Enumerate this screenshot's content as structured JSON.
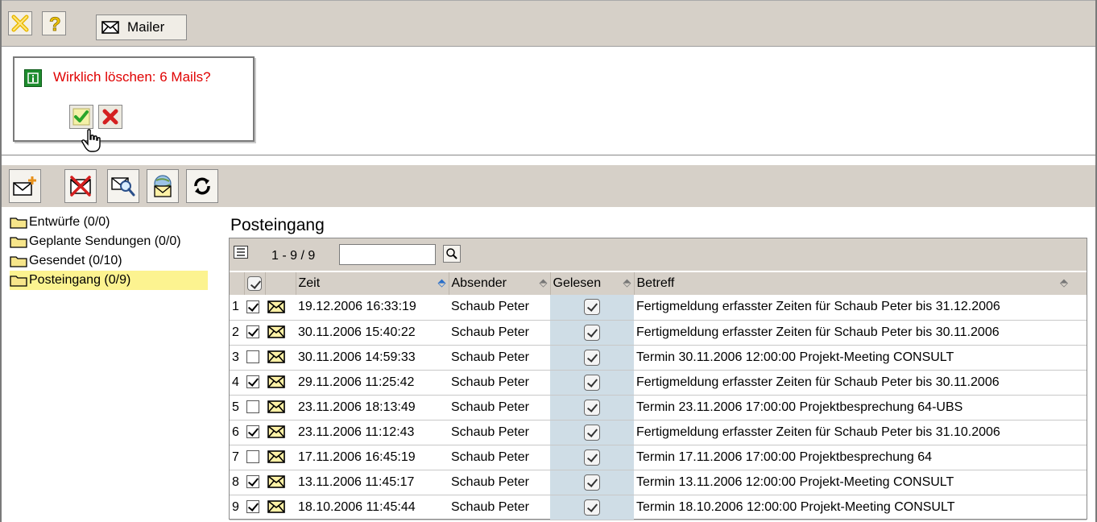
{
  "topbar": {
    "close_icon": "close-x-icon",
    "help_icon": "help-question-icon",
    "mailer_label": "Mailer"
  },
  "dialog": {
    "message": "Wirklich löschen: 6 Mails?",
    "confirm_icon": "check-icon",
    "cancel_icon": "cancel-x-icon"
  },
  "folders": [
    {
      "label": "Entwürfe (0/0)",
      "selected": false
    },
    {
      "label": "Geplante Sendungen (0/0)",
      "selected": false
    },
    {
      "label": "Gesendet (0/10)",
      "selected": false
    },
    {
      "label": "Posteingang (0/9)",
      "selected": true
    }
  ],
  "inbox": {
    "title": "Posteingang",
    "range": "1 - 9 / 9",
    "search_value": "",
    "columns": {
      "zeit": "Zeit",
      "absender": "Absender",
      "gelesen": "Gelesen",
      "betreff": "Betreff"
    },
    "rows": [
      {
        "num": "1",
        "checked": true,
        "zeit": "19.12.2006 16:33:19",
        "absender": "Schaub Peter",
        "betreff": "Fertigmeldung erfasster Zeiten für Schaub Peter bis 31.12.2006"
      },
      {
        "num": "2",
        "checked": true,
        "zeit": "30.11.2006 15:40:22",
        "absender": "Schaub Peter",
        "betreff": "Fertigmeldung erfasster Zeiten für Schaub Peter bis 30.11.2006"
      },
      {
        "num": "3",
        "checked": false,
        "zeit": "30.11.2006 14:59:33",
        "absender": "Schaub Peter",
        "betreff": "Termin 30.11.2006 12:00:00 Projekt-Meeting CONSULT"
      },
      {
        "num": "4",
        "checked": true,
        "zeit": "29.11.2006 11:25:42",
        "absender": "Schaub Peter",
        "betreff": "Fertigmeldung erfasster Zeiten für Schaub Peter bis 30.11.2006"
      },
      {
        "num": "5",
        "checked": false,
        "zeit": "23.11.2006 18:13:49",
        "absender": "Schaub Peter",
        "betreff": "Termin 23.11.2006 17:00:00 Projektbesprechung 64-UBS"
      },
      {
        "num": "6",
        "checked": true,
        "zeit": "23.11.2006 11:12:43",
        "absender": "Schaub Peter",
        "betreff": "Fertigmeldung erfasster Zeiten für Schaub Peter bis 31.10.2006"
      },
      {
        "num": "7",
        "checked": false,
        "zeit": "17.11.2006 16:45:19",
        "absender": "Schaub Peter",
        "betreff": "Termin 17.11.2006 17:00:00 Projektbesprechung 64"
      },
      {
        "num": "8",
        "checked": true,
        "zeit": "13.11.2006 11:45:17",
        "absender": "Schaub Peter",
        "betreff": "Termin 13.11.2006 12:00:00 Projekt-Meeting CONSULT"
      },
      {
        "num": "9",
        "checked": true,
        "zeit": "18.10.2006 11:45:44",
        "absender": "Schaub Peter",
        "betreff": "Termin 18.10.2006 12:00:00 Projekt-Meeting CONSULT"
      }
    ]
  },
  "colors": {
    "toolbar_bg": "#d6d0c8",
    "dialog_text": "#e00000",
    "selected_folder": "#fcf390",
    "gelesen_col": "#cfdde6"
  }
}
